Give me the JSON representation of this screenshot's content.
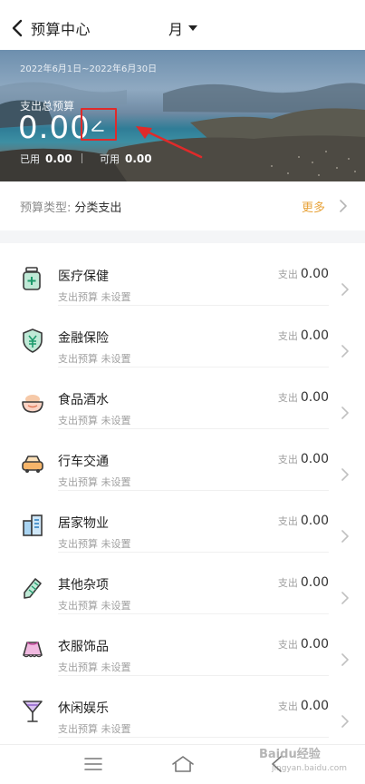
{
  "header": {
    "title": "预算中心",
    "period": "月"
  },
  "hero": {
    "date_range": "2022年6月1日~2022年6月30日",
    "total_label": "支出总预算",
    "total_amount": "0.00",
    "used_label": "已用",
    "used_value": "0.00",
    "available_label": "可用",
    "available_value": "0.00",
    "highlight_color": "#e02a2a"
  },
  "budget_type": {
    "label": "预算类型:",
    "value": "分类支出",
    "more": "更多",
    "accent_color": "#e8a33a"
  },
  "categories": [
    {
      "name": "医疗保健",
      "icon": "medicine-icon",
      "spent_label": "支出",
      "spent": "0.00",
      "budget_label": "支出预算",
      "budget_status": "未设置"
    },
    {
      "name": "金融保险",
      "icon": "finance-shield-icon",
      "spent_label": "支出",
      "spent": "0.00",
      "budget_label": "支出预算",
      "budget_status": "未设置"
    },
    {
      "name": "食品酒水",
      "icon": "food-bowl-icon",
      "spent_label": "支出",
      "spent": "0.00",
      "budget_label": "支出预算",
      "budget_status": "未设置"
    },
    {
      "name": "行车交通",
      "icon": "car-icon",
      "spent_label": "支出",
      "spent": "0.00",
      "budget_label": "支出预算",
      "budget_status": "未设置"
    },
    {
      "name": "居家物业",
      "icon": "building-icon",
      "spent_label": "支出",
      "spent": "0.00",
      "budget_label": "支出预算",
      "budget_status": "未设置"
    },
    {
      "name": "其他杂项",
      "icon": "tag-icon",
      "spent_label": "支出",
      "spent": "0.00",
      "budget_label": "支出预算",
      "budget_status": "未设置"
    },
    {
      "name": "衣服饰品",
      "icon": "clothing-icon",
      "spent_label": "支出",
      "spent": "0.00",
      "budget_label": "支出预算",
      "budget_status": "未设置"
    },
    {
      "name": "休闲娱乐",
      "icon": "cocktail-icon",
      "spent_label": "支出",
      "spent": "0.00",
      "budget_label": "支出预算",
      "budget_status": "未设置"
    }
  ],
  "watermark": {
    "text": "Baidu经验",
    "sub": "jingyan.baidu.com"
  }
}
